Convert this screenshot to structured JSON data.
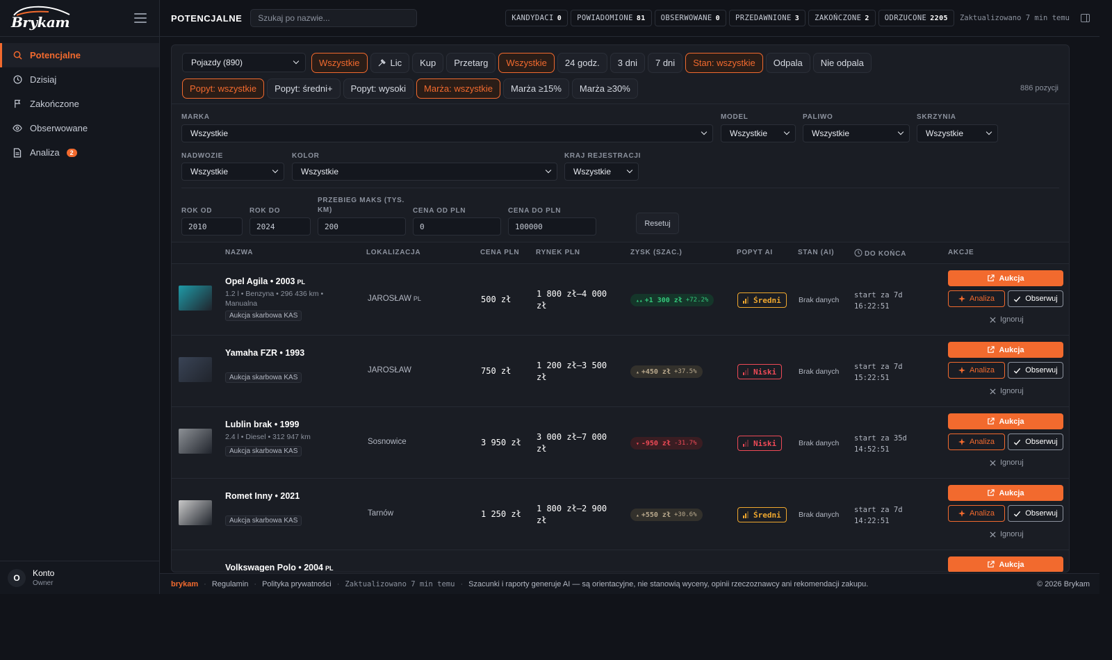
{
  "brand": {
    "name": "Brykam"
  },
  "nav": {
    "items": [
      {
        "label": "Potencjalne",
        "icon": "search-icon",
        "active": true
      },
      {
        "label": "Dzisiaj",
        "icon": "clock-icon"
      },
      {
        "label": "Zakończone",
        "icon": "flag-icon"
      },
      {
        "label": "Obserwowane",
        "icon": "eye-icon"
      },
      {
        "label": "Analiza",
        "icon": "document-icon",
        "badge": "2"
      }
    ]
  },
  "account": {
    "initial": "O",
    "name": "Konto",
    "role": "Owner"
  },
  "header": {
    "title": "POTENCJALNE",
    "search_placeholder": "Szukaj po nazwie...",
    "stats": [
      {
        "label": "KANDYDACI",
        "value": "0"
      },
      {
        "label": "POWIADOMIONE",
        "value": "81"
      },
      {
        "label": "OBSERWOWANE",
        "value": "0"
      },
      {
        "label": "PRZEDAWNIONE",
        "value": "3"
      },
      {
        "label": "ZAKOŃCZONE",
        "value": "2"
      },
      {
        "label": "ODRZUCONE",
        "value": "2205"
      }
    ],
    "updated": "Zaktualizowano 7 min temu"
  },
  "chips": {
    "category": "Pojazdy (890)",
    "row1": [
      "Wszystkie",
      "Lic",
      "Kup",
      "Przetarg",
      "Wszystkie",
      "24 godz.",
      "3 dni",
      "7 dni",
      "Stan: wszystkie",
      "Odpala",
      "Nie odpala"
    ],
    "row2": [
      "Popyt: wszystkie",
      "Popyt: średni+",
      "Popyt: wysoki",
      "Marża: wszystkie",
      "Marża ≥15%",
      "Marża ≥30%"
    ],
    "count": "886 pozycji"
  },
  "filters": {
    "marka": {
      "label": "MARKA",
      "value": "Wszystkie"
    },
    "model": {
      "label": "MODEL",
      "value": "Wszystkie"
    },
    "paliwo": {
      "label": "PALIWO",
      "value": "Wszystkie"
    },
    "skrzynia": {
      "label": "SKRZYNIA",
      "value": "Wszystkie"
    },
    "nadwozie": {
      "label": "NADWOZIE",
      "value": "Wszystkie"
    },
    "kolor": {
      "label": "KOLOR",
      "value": "Wszystkie"
    },
    "kraj": {
      "label": "KRAJ REJESTRACJI",
      "value": "Wszystkie"
    },
    "rok_od": {
      "label": "ROK OD",
      "value": "2010"
    },
    "rok_do": {
      "label": "ROK DO",
      "value": "2024"
    },
    "przebieg": {
      "label": "PRZEBIEG MAKS (TYS. KM)",
      "value": "200"
    },
    "cena_od": {
      "label": "CENA OD PLN",
      "value": "0"
    },
    "cena_do": {
      "label": "CENA DO PLN",
      "value": "100000"
    },
    "reset_label": "Resetuj"
  },
  "table": {
    "headers": [
      "NAZWA",
      "LOKALIZACJA",
      "CENA PLN",
      "RYNEK PLN",
      "ZYSK (SZAC.)",
      "POPYT AI",
      "STAN (AI)",
      "DO KOŃCA",
      "AKCJE"
    ],
    "actions": {
      "auction": "Aukcja",
      "analysis": "Analiza",
      "observe": "Obserwuj",
      "ignore": "Ignoruj"
    },
    "rows": [
      {
        "name": "Opel Agila • 2003",
        "flag": "PL",
        "spec": "1.2 l • Benzyna • 296 436 km • Manualna",
        "tag": "Aukcja skarbowa KAS",
        "location": "JAROSŁAW",
        "location_flag": "PL",
        "price": "500 zł",
        "market": "1 800 zł–4 000 zł",
        "profit": "+1 300 zł",
        "profit_pct": "+72.2%",
        "profit_kind": "pos",
        "demand": "Średni",
        "demand_kind": "avg",
        "stan": "Brak danych",
        "end1": "start za 7d",
        "end2": "16:22:51",
        "thumb": "#1f9aa7"
      },
      {
        "name": "Yamaha FZR • 1993",
        "flag": "",
        "spec": "",
        "tag": "Aukcja skarbowa KAS",
        "location": "JAROSŁAW",
        "location_flag": "",
        "price": "750 zł",
        "market": "1 200 zł–3 500 zł",
        "profit": "+450 zł",
        "profit_pct": "+37.5%",
        "profit_kind": "mid",
        "demand": "Niski",
        "demand_kind": "low",
        "stan": "Brak danych",
        "end1": "start za 7d",
        "end2": "15:22:51",
        "thumb": "#3a4456"
      },
      {
        "name": "Lublin brak • 1999",
        "flag": "",
        "spec": "2.4 l • Diesel • 312 947 km",
        "tag": "Aukcja skarbowa KAS",
        "location": "Sosnowice",
        "location_flag": "",
        "price": "3 950 zł",
        "market": "3 000 zł–7 000 zł",
        "profit": "-950 zł",
        "profit_pct": "-31.7%",
        "profit_kind": "neg",
        "demand": "Niski",
        "demand_kind": "low",
        "stan": "Brak danych",
        "end1": "start za 35d",
        "end2": "14:52:51",
        "thumb": "#8d9196"
      },
      {
        "name": "Romet Inny • 2021",
        "flag": "",
        "spec": "",
        "tag": "Aukcja skarbowa KAS",
        "location": "Tarnów",
        "location_flag": "",
        "price": "1 250 zł",
        "market": "1 800 zł–2 900 zł",
        "profit": "+550 zł",
        "profit_pct": "+30.6%",
        "profit_kind": "mid",
        "demand": "Średni",
        "demand_kind": "avg",
        "stan": "Brak danych",
        "end1": "start za 7d",
        "end2": "14:22:51",
        "thumb": "#c9c9c9"
      },
      {
        "name": "Volkswagen Polo • 2004",
        "flag": "PL",
        "spec": "",
        "tag": "",
        "location": "",
        "location_flag": "",
        "price": "",
        "market": "",
        "profit": "",
        "profit_pct": "",
        "profit_kind": "pos",
        "demand": "",
        "demand_kind": "avg",
        "stan": "",
        "end1": "",
        "end2": "",
        "thumb": "#444"
      }
    ]
  },
  "footer": {
    "brand": "brykam",
    "terms": "Regulamin",
    "privacy": "Polityka prywatności",
    "updated": "Zaktualizowano 7 min temu",
    "disclaimer": "Szacunki i raporty generuje AI — są orientacyjne, nie stanowią wyceny, opinii rzeczoznawcy ani rekomendacji zakupu.",
    "copyright": "© 2026 Brykam"
  },
  "colors": {
    "accent": "#f26a2e",
    "positive": "#34c77b",
    "negative": "#ef4a57",
    "warning": "#f0a82e"
  }
}
